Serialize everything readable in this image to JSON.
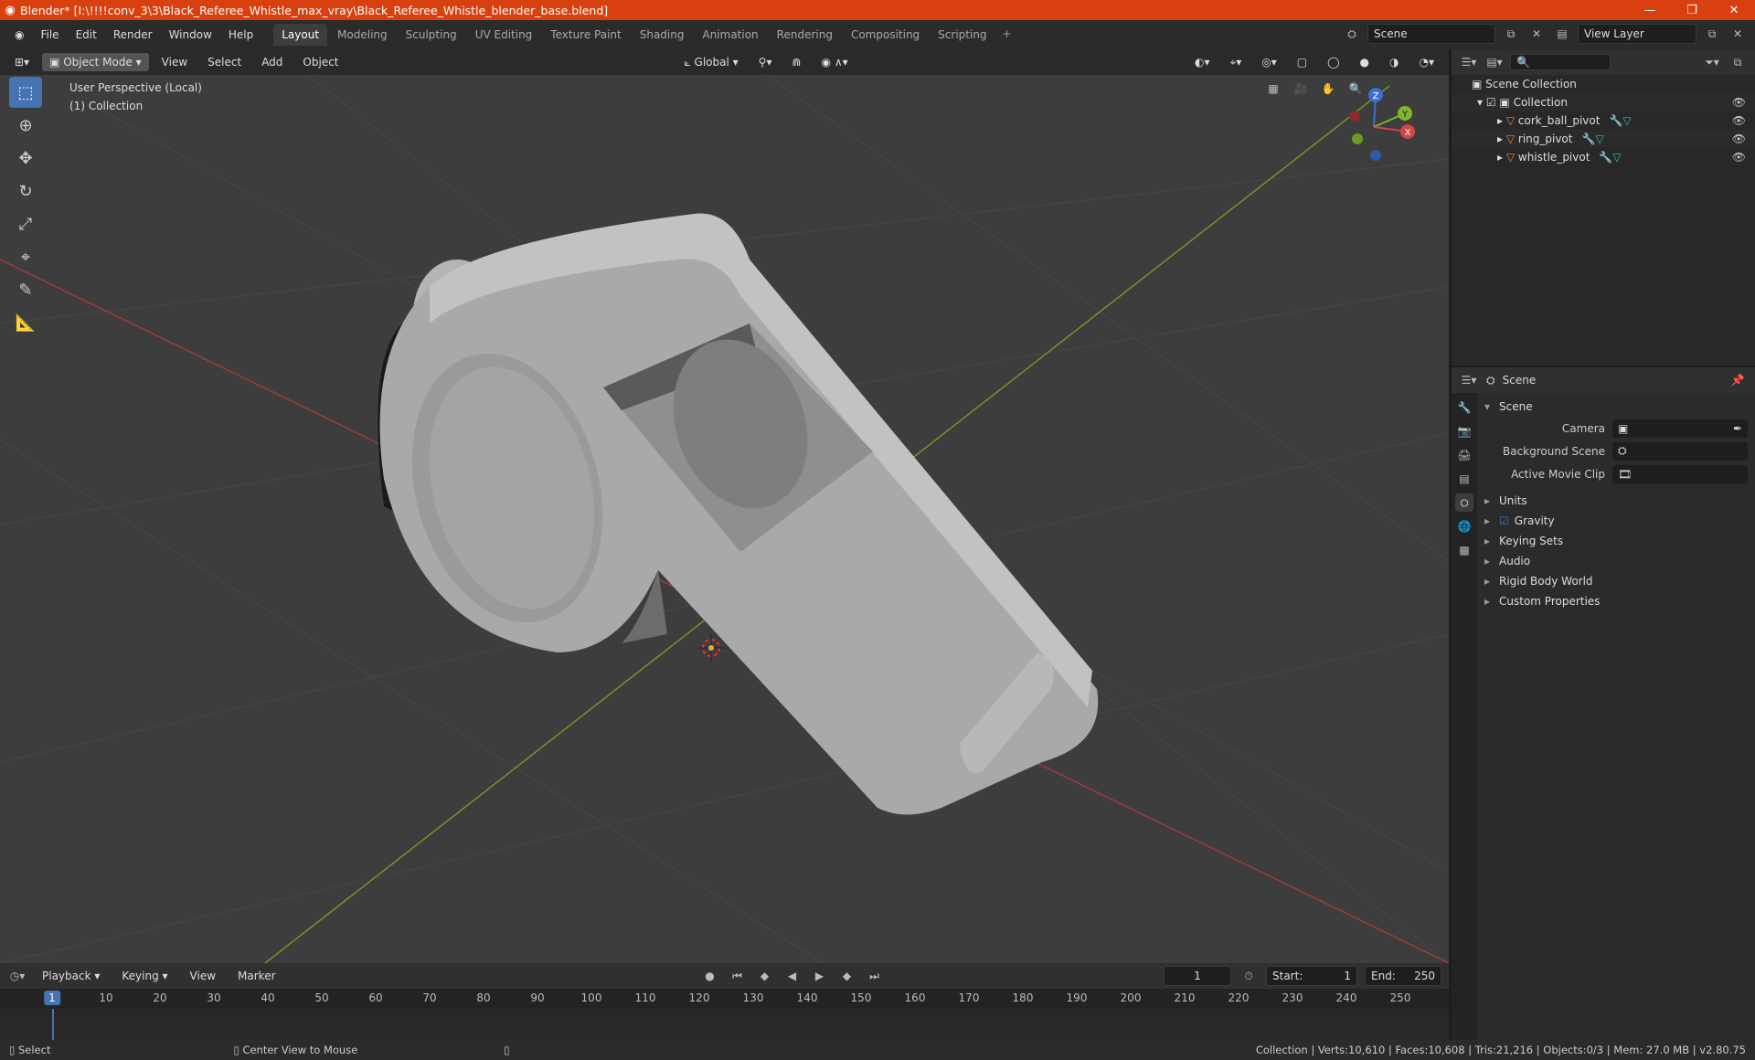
{
  "window": {
    "title": "Blender* [I:\\!!!!conv_3\\3\\Black_Referee_Whistle_max_vray\\Black_Referee_Whistle_blender_base.blend]",
    "minimize": "—",
    "maximize": "❐",
    "close": "✕"
  },
  "menu": [
    "File",
    "Edit",
    "Render",
    "Window",
    "Help"
  ],
  "workspaces": [
    "Layout",
    "Modeling",
    "Sculpting",
    "UV Editing",
    "Texture Paint",
    "Shading",
    "Animation",
    "Rendering",
    "Compositing",
    "Scripting"
  ],
  "active_workspace": "Layout",
  "scene_field": "Scene",
  "view_layer_field": "View Layer",
  "viewport": {
    "mode": "Object Mode",
    "menus": [
      "View",
      "Select",
      "Add",
      "Object"
    ],
    "orientation": "Global",
    "info_line1": "User Perspective (Local)",
    "info_line2": "(1) Collection",
    "axis_x": "X",
    "axis_y": "Y",
    "axis_z": "Z"
  },
  "outliner": {
    "root": "Scene Collection",
    "collection": "Collection",
    "items": [
      "cork_ball_pivot",
      "ring_pivot",
      "whistle_pivot"
    ]
  },
  "properties": {
    "header": "Scene",
    "panel": "Scene",
    "camera_label": "Camera",
    "bg_scene_label": "Background Scene",
    "movie_clip_label": "Active Movie Clip",
    "sections": [
      "Units",
      "Gravity",
      "Keying Sets",
      "Audio",
      "Rigid Body World",
      "Custom Properties"
    ]
  },
  "timeline": {
    "menus": [
      "Playback",
      "Keying",
      "View",
      "Marker"
    ],
    "current_frame": "1",
    "start_label": "Start:",
    "start": "1",
    "end_label": "End:",
    "end": "250",
    "ticks": [
      "10",
      "20",
      "30",
      "40",
      "50",
      "60",
      "70",
      "80",
      "90",
      "100",
      "110",
      "120",
      "130",
      "140",
      "150",
      "160",
      "170",
      "180",
      "190",
      "200",
      "210",
      "220",
      "230",
      "240",
      "250"
    ]
  },
  "status": {
    "left1": "Select",
    "left2": "Center View to Mouse",
    "right": "Collection | Verts:10,610 | Faces:10,608 | Tris:21,216 | Objects:0/3 | Mem: 27.0 MB | v2.80.75"
  },
  "colors": {
    "accent": "#4772b3",
    "title_bar": "#d9400f",
    "viewport_bg": "#3d3d3d",
    "x_axis": "#a63a3a",
    "y_axis": "#7a9a25"
  }
}
